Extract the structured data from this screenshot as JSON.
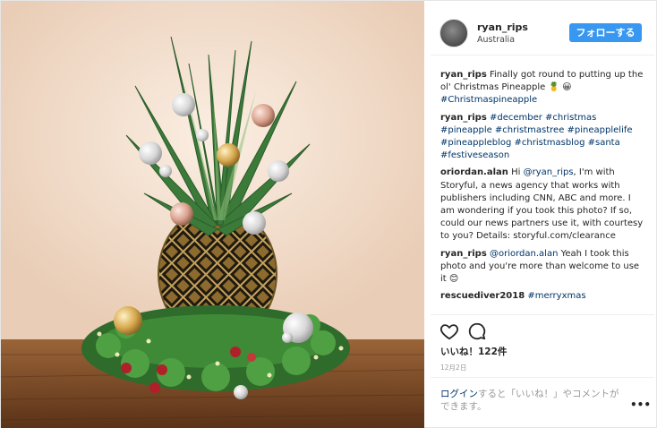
{
  "post": {
    "username": "ryan_rips",
    "location": "Australia",
    "follow_label": "フォローする"
  },
  "comments": [
    {
      "user": "ryan_rips",
      "text": "Finally got round to putting up the ol' Christmas Pineapple",
      "emoji": "🍍 😀",
      "tags": "#Christmaspineapple"
    },
    {
      "user": "ryan_rips",
      "text": "",
      "tags": "#december #christmas #pineapple #christmastree #pineapplelife #pineappleblog #christmasblog #santa #festiveseason"
    },
    {
      "user": "oriordan.alan",
      "text_before": "Hi",
      "mention": "@ryan_rips",
      "text": ", I'm with Storyful, a news agency that works with publishers including CNN, ABC and more. I am wondering if you took this photo? If so, could our news partners use it, with courtesy to you? Details: storyful.com/clearance"
    },
    {
      "user": "ryan_rips",
      "mention": "@oriordan.alan",
      "text": " Yeah I took this photo and you're more than welcome to use it",
      "emoji": "😊"
    },
    {
      "user": "rescuediver2018",
      "tags": "#merryxmas"
    }
  ],
  "likes": "いいね！122件",
  "date": "12月2日",
  "login": {
    "link": "ログイン",
    "text": "すると「いいね！」やコメントができます。"
  },
  "more_label": "•••",
  "icons": {
    "like": "heart-icon",
    "comment": "comment-icon",
    "more": "more-options-icon"
  },
  "colors": {
    "accent": "#3897f0",
    "link": "#003569",
    "muted": "#999999"
  }
}
